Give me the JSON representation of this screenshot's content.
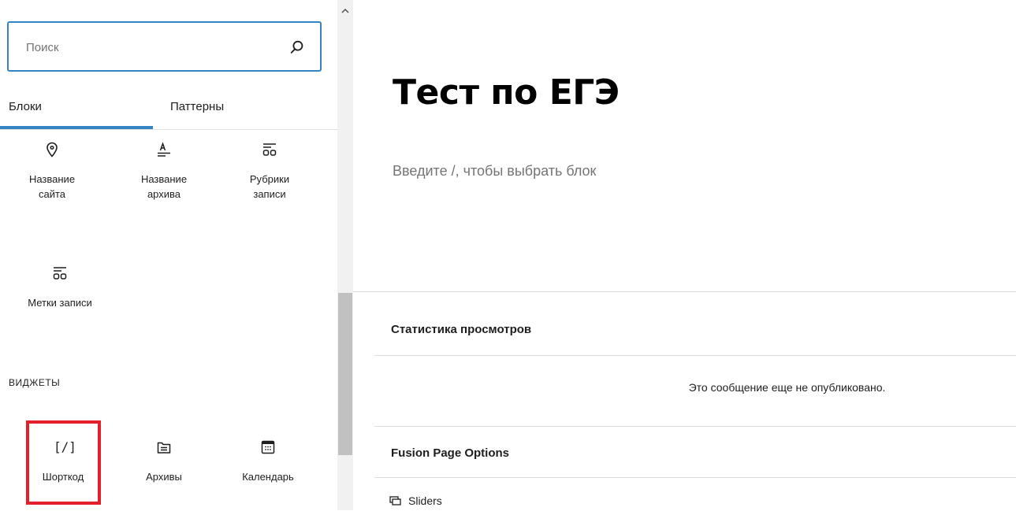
{
  "search": {
    "placeholder": "Поиск",
    "value": ""
  },
  "tabs": {
    "blocks": "Блоки",
    "patterns": "Паттерны"
  },
  "blocks": [
    {
      "label_line1": "Название",
      "label_line2": "сайта",
      "icon": "map-marker-icon"
    },
    {
      "label_line1": "Название",
      "label_line2": "архива",
      "icon": "archive-title-icon"
    },
    {
      "label_line1": "Рубрики",
      "label_line2": "записи",
      "icon": "post-terms-icon"
    },
    {
      "label_line1": "Метки записи",
      "label_line2": "",
      "icon": "post-terms-icon"
    }
  ],
  "widgets": {
    "section_title": "ВИДЖЕТЫ",
    "items": [
      {
        "label": "Шорткод",
        "icon": "shortcode-icon",
        "icon_text": "[/]"
      },
      {
        "label": "Архивы",
        "icon": "archive-folder-icon"
      },
      {
        "label": "Календарь",
        "icon": "calendar-icon"
      }
    ]
  },
  "editor": {
    "title": "Тест по ЕГЭ",
    "appender_text": "Введите /, чтобы выбрать блок"
  },
  "meta": {
    "stats_title": "Статистика просмотров",
    "stats_message": "Это сообщение еще не опубликовано.",
    "fusion_title": "Fusion Page Options",
    "sliders_label": "Sliders"
  },
  "colors": {
    "accent": "#3582c4",
    "highlight": "#e3202a"
  }
}
